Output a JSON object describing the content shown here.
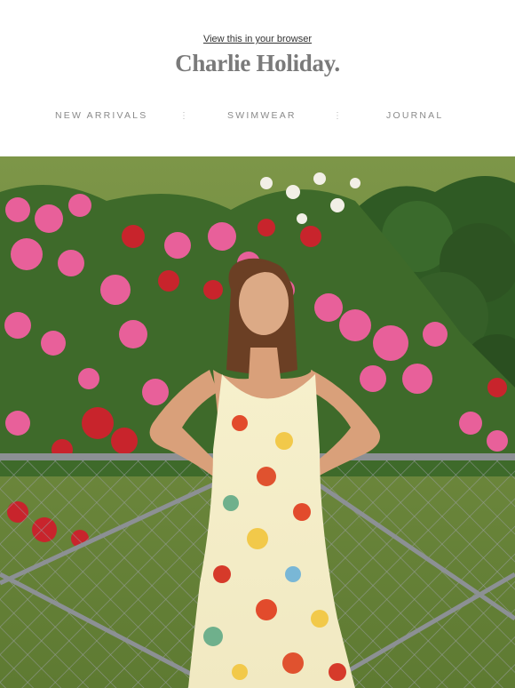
{
  "header": {
    "view_link": "View this in your browser",
    "brand": "Charlie Holiday."
  },
  "nav": {
    "items": [
      {
        "label": "NEW ARRIVALS"
      },
      {
        "label": "SWIMWEAR"
      },
      {
        "label": "JOURNAL"
      }
    ],
    "separator": "⋮"
  },
  "hero": {
    "image_name": "model-in-floral-dress-photo",
    "colors": {
      "grass": "#6f8a3e",
      "hedge": "#2f5a24",
      "rose_pink": "#e8609a",
      "rose_red": "#c8242c",
      "rose_white": "#f2efe6",
      "fence": "#8c9094",
      "hair": "#6b3f24",
      "skin": "#d9a07a",
      "dress_base": "#f4efc8"
    }
  }
}
